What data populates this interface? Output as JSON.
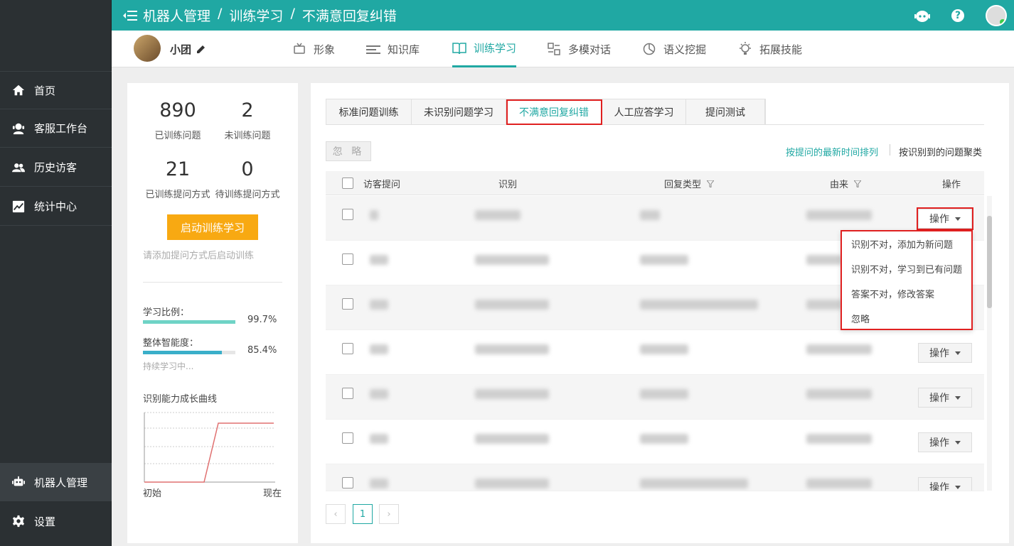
{
  "topbar": {
    "breadcrumb": [
      "机器人管理",
      "训练学习",
      "不满意回复纠错"
    ],
    "separator": "/",
    "help": "?"
  },
  "sidebar": {
    "items": [
      {
        "label": "首页",
        "icon": "home-icon"
      },
      {
        "label": "客服工作台",
        "icon": "agent-icon"
      },
      {
        "label": "历史访客",
        "icon": "users-icon"
      },
      {
        "label": "统计中心",
        "icon": "chart-icon"
      },
      {
        "label": "机器人管理",
        "icon": "robot-icon"
      },
      {
        "label": "设置",
        "icon": "gear-icon"
      }
    ]
  },
  "subbar": {
    "bot_name": "小团",
    "tabs": [
      {
        "label": "形象",
        "icon": "tv-icon"
      },
      {
        "label": "知识库",
        "icon": "list-icon"
      },
      {
        "label": "训练学习",
        "icon": "book-icon"
      },
      {
        "label": "多模对话",
        "icon": "multi-icon"
      },
      {
        "label": "语义挖掘",
        "icon": "pie-icon"
      },
      {
        "label": "拓展技能",
        "icon": "bulb-icon"
      }
    ]
  },
  "stats": {
    "trained_questions": "890",
    "trained_questions_label": "已训练问题",
    "untrained_questions": "2",
    "untrained_questions_label": "未训练问题",
    "trained_ways": "21",
    "trained_ways_label": "已训练提问方式",
    "pending_ways": "0",
    "pending_ways_label": "待训练提问方式",
    "start_button": "启动训练学习",
    "hint": "请添加提问方式后启动训练"
  },
  "metrics": {
    "learning_ratio_label": "学习比例：",
    "learning_ratio_value": "99.7%",
    "learning_ratio_fraction": 0.997,
    "intelligence_label": "整体智能度：",
    "intelligence_value": "85.4%",
    "intelligence_fraction": 0.854,
    "sub_hint": "持续学习中...",
    "chart_title": "识别能力成长曲线",
    "chart_start": "初始",
    "chart_end": "现在",
    "color_ratio": "#6fd3c6",
    "color_intel": "#3aafc9"
  },
  "main": {
    "tabs": [
      "标准问题训练",
      "未识别问题学习",
      "不满意回复纠错",
      "人工应答学习",
      "提问测试"
    ],
    "ignore_button": "忽 略",
    "sort_time": "按提问的最新时间排列",
    "sort_cluster": "按识别到的问题聚类",
    "columns": [
      "访客提问",
      "识别",
      "回复类型",
      "由来",
      "操作"
    ],
    "op_label": "操作",
    "dropdown": [
      "识别不对，添加为新问题",
      "识别不对，学习到已有问题",
      "答案不对，修改答案",
      "忽略"
    ],
    "page": "1",
    "prev": "‹",
    "next": "›"
  }
}
